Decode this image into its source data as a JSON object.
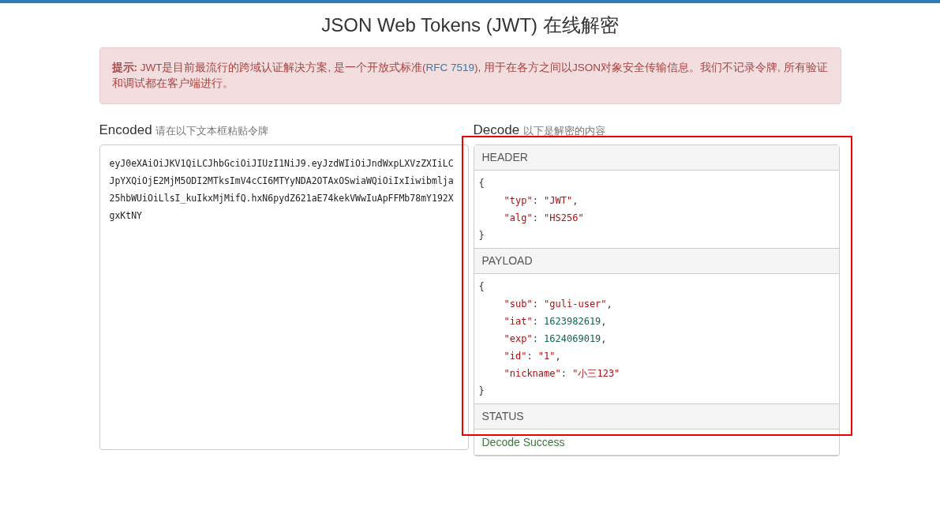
{
  "title": "JSON Web Tokens (JWT) 在线解密",
  "alert": {
    "label": "提示:",
    "text": "JWT是目前最流行的跨域认证解决方案, 是一个开放式标准(",
    "link": "RFC 7519",
    "text_after": "), 用于在各方之间以JSON对象安全传输信息。我们不记录令牌, 所有验证和调试都在客户端进行。"
  },
  "encoded": {
    "heading": "Encoded",
    "hint": "请在以下文本框粘贴令牌",
    "value": "eyJ0eXAiOiJKV1QiLCJhbGciOiJIUzI1NiJ9.eyJzdWIiOiJndWxpLXVzZXIiLCJpYXQiOjE2MjM5ODI2MTksImV4cCI6MTYyNDA2OTAxOSwiaWQiOiIxIiwibmlja25hbWUiOiLlsI_kuIkxMjMifQ.hxN6pydZ621aE74kekVWwIuApFFMb78mY192XgxKtNY"
  },
  "decode": {
    "heading": "Decode",
    "hint": "以下是解密的内容",
    "sections": [
      {
        "title": "HEADER",
        "kind": "json",
        "open": "{",
        "close": "}",
        "lines": [
          {
            "key": "\"typ\"",
            "colon": ": ",
            "value": "\"JWT\"",
            "kind": "string",
            "comma": ","
          },
          {
            "key": "\"alg\"",
            "colon": ": ",
            "value": "\"HS256\"",
            "kind": "string"
          }
        ]
      },
      {
        "title": "PAYLOAD",
        "kind": "json",
        "open": "{",
        "close": "}",
        "lines": [
          {
            "key": "\"sub\"",
            "colon": ": ",
            "value": "\"guli-user\"",
            "kind": "string",
            "comma": ","
          },
          {
            "key": "\"iat\"",
            "colon": ": ",
            "value": "1623982619",
            "kind": "number",
            "comma": ","
          },
          {
            "key": "\"exp\"",
            "colon": ": ",
            "value": "1624069019",
            "kind": "number",
            "comma": ","
          },
          {
            "key": "\"id\"",
            "colon": ": ",
            "value": "\"1\"",
            "kind": "string",
            "comma": ","
          },
          {
            "key": "\"nickname\"",
            "colon": ": ",
            "value": "\"小三123\"",
            "kind": "string"
          }
        ]
      },
      {
        "title": "STATUS",
        "kind": "status",
        "text": "Decode Success"
      }
    ]
  }
}
